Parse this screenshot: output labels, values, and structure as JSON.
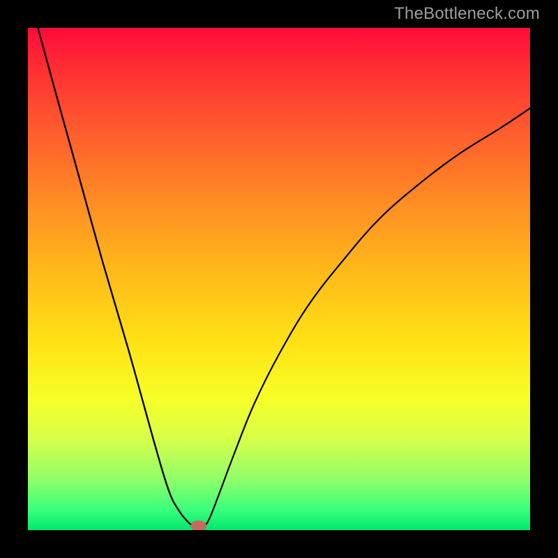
{
  "watermark": "TheBottleneck.com",
  "chart_data": {
    "type": "line",
    "title": "",
    "xlabel": "",
    "ylabel": "",
    "xlim": [
      0,
      100
    ],
    "ylim": [
      0,
      100
    ],
    "series": [
      {
        "name": "curve-left",
        "x": [
          2,
          5,
          10,
          15,
          20,
          25,
          28,
          30,
          32,
          33.5,
          34.5
        ],
        "values": [
          100,
          89,
          71,
          53,
          36,
          18,
          8,
          4,
          1.5,
          0.5,
          0
        ]
      },
      {
        "name": "curve-right",
        "x": [
          34.5,
          36,
          38,
          41,
          45,
          50,
          56,
          63,
          70,
          78,
          86,
          94,
          100
        ],
        "values": [
          0,
          2,
          7,
          15,
          25,
          35,
          45,
          54,
          62,
          69,
          75,
          80,
          84
        ]
      }
    ],
    "marker": {
      "name": "bottleneck-marker",
      "x": 34,
      "y": 0,
      "rx": 1.6,
      "ry": 1.1,
      "color": "#c66a5f"
    },
    "gradient_stops": [
      {
        "pos": 0,
        "color": "#ff0a3a"
      },
      {
        "pos": 8,
        "color": "#ff2e33"
      },
      {
        "pos": 20,
        "color": "#ff5a2e"
      },
      {
        "pos": 34,
        "color": "#ff8a24"
      },
      {
        "pos": 48,
        "color": "#ffb81a"
      },
      {
        "pos": 62,
        "color": "#ffe015"
      },
      {
        "pos": 74,
        "color": "#f7ff28"
      },
      {
        "pos": 82,
        "color": "#d6ff4a"
      },
      {
        "pos": 90,
        "color": "#8fff6a"
      },
      {
        "pos": 96,
        "color": "#38ff7c"
      },
      {
        "pos": 100,
        "color": "#00e76e"
      }
    ]
  }
}
